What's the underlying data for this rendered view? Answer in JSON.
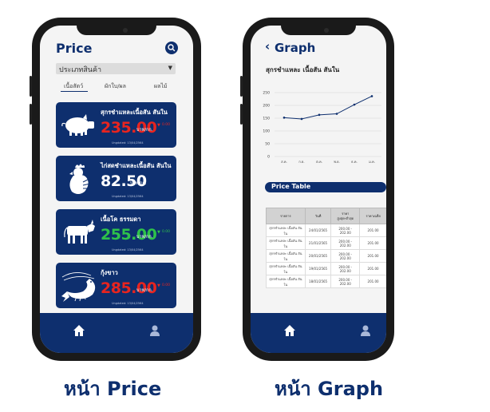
{
  "price_page": {
    "title": "Price",
    "category_select": {
      "value": "ประเภทสินค้า"
    },
    "tabs": [
      "เนื้อสัตว์",
      "ผักใบ/ผล",
      "ผลไม้"
    ],
    "cards": [
      {
        "name": "สุกรชำแหละเนื้อสัน สันใน",
        "price": "235.00",
        "unit": "บาท/กก.",
        "change": "0.00",
        "updated": "Ungdated: 13/04/2564",
        "price_color": "#e8241f",
        "trend": "down"
      },
      {
        "name": "ไก่สดชำแหละเนื้อสัน สันใน",
        "price": "82.50",
        "unit": "บาท/กก.",
        "change": "",
        "updated": "Ungdated: 13/04/2564",
        "price_color": "#ffffff",
        "trend": ""
      },
      {
        "name": "เนื้อโค ธรรมดา",
        "price": "255.00",
        "unit": "บาท/กก.",
        "change": "0.00",
        "updated": "Ungdated: 13/04/2564",
        "price_color": "#2ec24a",
        "trend": "up"
      },
      {
        "name": "กุ้งขาว",
        "price": "285.00",
        "unit": "บาท/กก.",
        "change": "0.00",
        "updated": "Ungdated: 13/04/2564",
        "price_color": "#e8241f",
        "trend": "down"
      }
    ],
    "nav": [
      "home-icon",
      "user-icon"
    ]
  },
  "graph_page": {
    "back": "‹",
    "title": "Graph",
    "subtitle": "สุกรชำแหละ เนื้อสัน สันใน",
    "section_label": "Price Table",
    "table": {
      "headers": [
        "รายการ",
        "วันที่",
        "ราคา\nสูงสุด-ต่ำสุด",
        "ราคาเฉลี่ย"
      ],
      "rows": [
        [
          "สุกรชำแหละ เนื้อสัน สันใน",
          "24/01/2565",
          "200.00 - 202.00",
          "201.00"
        ],
        [
          "สุกรชำแหละ เนื้อสัน สันใน",
          "21/01/2565",
          "200.00 - 202.00",
          "201.00"
        ],
        [
          "สุกรชำแหละ เนื้อสัน สันใน",
          "20/01/2565",
          "200.00 - 202.00",
          "201.00"
        ],
        [
          "สุกรชำแหละ เนื้อสัน สันใน",
          "19/01/2565",
          "200.00 - 202.00",
          "201.00"
        ],
        [
          "สุกรชำแหละ เนื้อสัน สันใน",
          "18/01/2565",
          "200.00 - 202.00",
          "201.00"
        ]
      ]
    },
    "nav": [
      "home-icon",
      "user-icon"
    ]
  },
  "captions": {
    "price": "หน้า Price",
    "graph": "หน้า Graph"
  },
  "colors": {
    "brand": "#0e2f6e",
    "down": "#e8241f",
    "up": "#2ec24a"
  },
  "chart_data": {
    "type": "line",
    "x": [
      "ส.ค.",
      "ก.ย.",
      "ต.ค.",
      "พ.ย.",
      "ธ.ค.",
      "ม.ค."
    ],
    "series": [
      {
        "values": [
          152,
          147,
          163,
          167,
          203,
          236
        ]
      }
    ],
    "ylim": [
      0,
      250
    ],
    "yticks": [
      0,
      50,
      100,
      150,
      200,
      250
    ],
    "grid": true,
    "color": "#0e2f6e"
  }
}
